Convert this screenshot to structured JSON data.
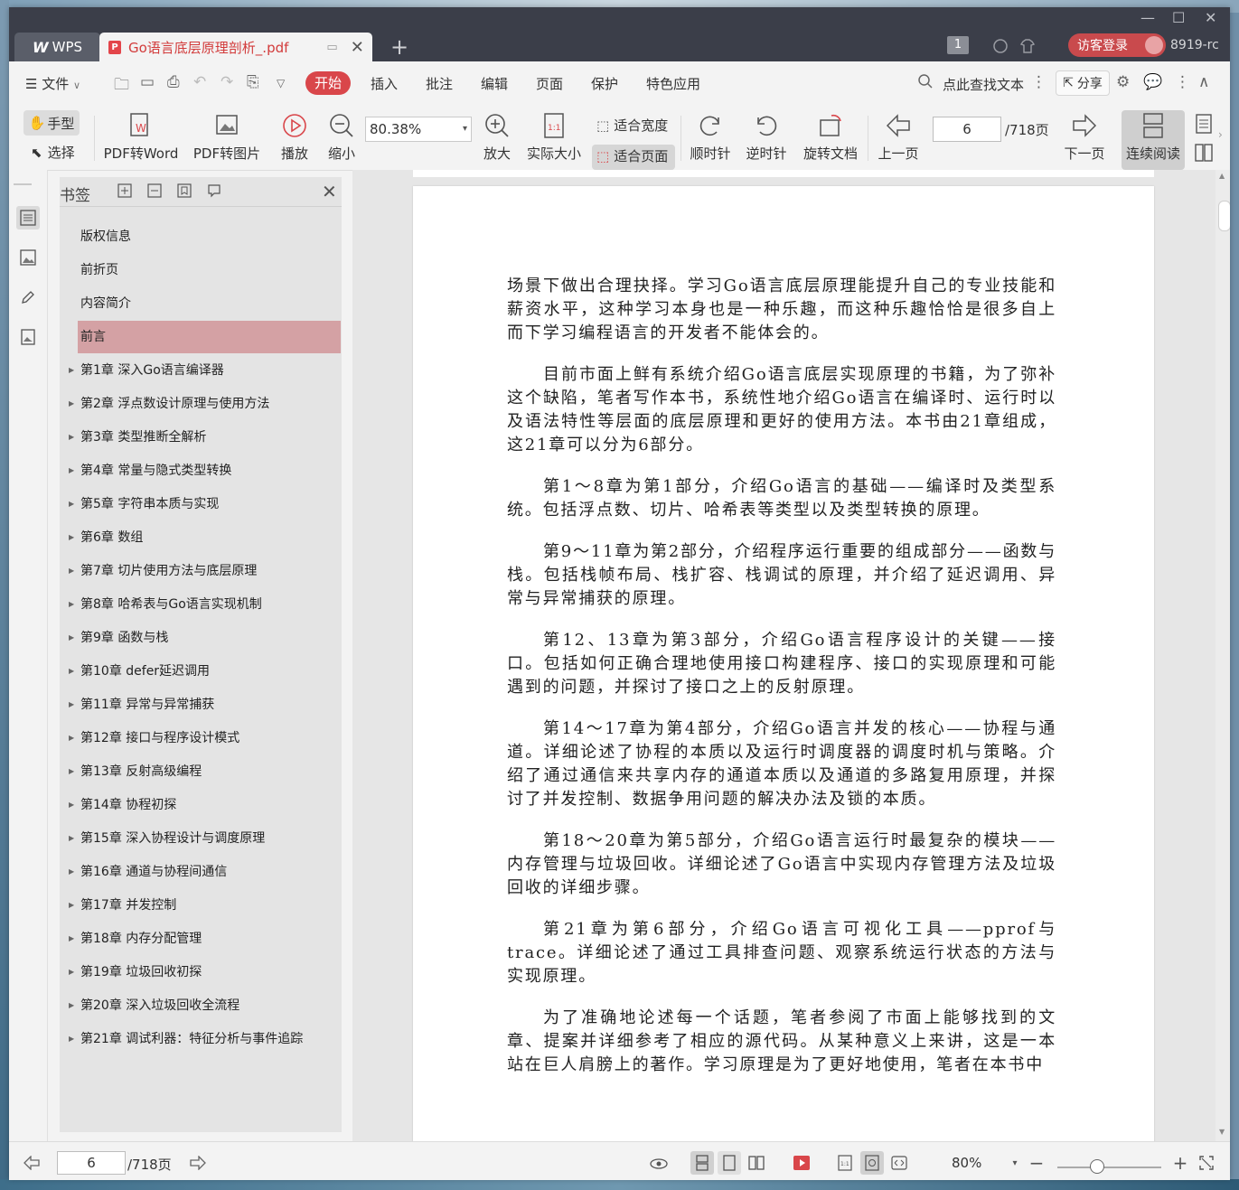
{
  "title_bar": {
    "app_tab": "WPS",
    "doc_tab": "Go语言底层原理剖析_.pdf",
    "page_badge": "1",
    "login": "访客登录",
    "user": "8919-rc"
  },
  "menu": {
    "file": "文件",
    "items": [
      "开始",
      "插入",
      "批注",
      "编辑",
      "页面",
      "保护",
      "特色应用"
    ],
    "search": "点此查找文本",
    "share": "分享"
  },
  "ribbon": {
    "hand": "手型",
    "select": "选择",
    "pdf_to_word": "PDF转Word",
    "pdf_to_image": "PDF转图片",
    "play": "播放",
    "zoom_out": "缩小",
    "zoom_value": "80.38%",
    "zoom_in": "放大",
    "actual_size": "实际大小",
    "fit_width": "适合宽度",
    "fit_page": "适合页面",
    "rotate_cw": "顺时针",
    "rotate_ccw": "逆时针",
    "rotate_doc": "旋转文档",
    "prev_page": "上一页",
    "page_current": "6",
    "page_total": "/718页",
    "next_page": "下一页",
    "continuous": "连续阅读"
  },
  "bookmarks": {
    "title": "书签",
    "items": [
      {
        "label": "版权信息"
      },
      {
        "label": "前折页"
      },
      {
        "label": "内容简介"
      },
      {
        "label": "前言"
      },
      {
        "label": "第1章 深入Go语言编译器"
      },
      {
        "label": "第2章 浮点数设计原理与使用方法"
      },
      {
        "label": "第3章 类型推断全解析"
      },
      {
        "label": "第4章 常量与隐式类型转换"
      },
      {
        "label": "第5章 字符串本质与实现"
      },
      {
        "label": "第6章 数组"
      },
      {
        "label": "第7章 切片使用方法与底层原理"
      },
      {
        "label": "第8章 哈希表与Go语言实现机制"
      },
      {
        "label": "第9章 函数与栈"
      },
      {
        "label": "第10章 defer延迟调用"
      },
      {
        "label": "第11章 异常与异常捕获"
      },
      {
        "label": "第12章 接口与程序设计模式"
      },
      {
        "label": "第13章 反射高级编程"
      },
      {
        "label": "第14章 协程初探"
      },
      {
        "label": "第15章 深入协程设计与调度原理"
      },
      {
        "label": "第16章 通道与协程间通信"
      },
      {
        "label": "第17章 并发控制"
      },
      {
        "label": "第18章 内存分配管理"
      },
      {
        "label": "第19章 垃圾回收初探"
      },
      {
        "label": "第20章 深入垃圾回收全流程"
      },
      {
        "label": "第21章 调试利器：特征分析与事件追踪"
      }
    ]
  },
  "document": {
    "paragraphs": [
      "场景下做出合理抉择。学习Go语言底层原理能提升自己的专业技能和薪资水平，这种学习本身也是一种乐趣，而这种乐趣恰恰是很多自上而下学习编程语言的开发者不能体会的。",
      "目前市面上鲜有系统介绍Go语言底层实现原理的书籍，为了弥补这个缺陷，笔者写作本书，系统性地介绍Go语言在编译时、运行时以及语法特性等层面的底层原理和更好的使用方法。本书由21章组成，这21章可以分为6部分。",
      "第1～8章为第1部分，介绍Go语言的基础——编译时及类型系统。包括浮点数、切片、哈希表等类型以及类型转换的原理。",
      "第9～11章为第2部分，介绍程序运行重要的组成部分——函数与栈。包括栈帧布局、栈扩容、栈调试的原理，并介绍了延迟调用、异常与异常捕获的原理。",
      "第12、13章为第3部分，介绍Go语言程序设计的关键——接口。包括如何正确合理地使用接口构建程序、接口的实现原理和可能遇到的问题，并探讨了接口之上的反射原理。",
      "第14～17章为第4部分，介绍Go语言并发的核心——协程与通道。详细论述了协程的本质以及运行时调度器的调度时机与策略。介绍了通过通信来共享内存的通道本质以及通道的多路复用原理，并探讨了并发控制、数据争用问题的解决办法及锁的本质。",
      "第18～20章为第5部分，介绍Go语言运行时最复杂的模块——内存管理与垃圾回收。详细论述了Go语言中实现内存管理方法及垃圾回收的详细步骤。",
      "第21章为第6部分，介绍Go语言可视化工具——pprof与trace。详细论述了通过工具排查问题、观察系统运行状态的方法与实现原理。",
      "为了准确地论述每一个话题，笔者参阅了市面上能够找到的文章、提案并详细参考了相应的源代码。从某种意义上来讲，这是一本站在巨人肩膀上的著作。学习原理是为了更好地使用，笔者在本书中"
    ]
  },
  "status_bar": {
    "page_current": "6",
    "page_total": "/718页",
    "zoom": "80%"
  },
  "colors": {
    "accent": "#d9464a",
    "bookmark_active": "#d4a1a4",
    "titlebar": "#3b3e49"
  }
}
